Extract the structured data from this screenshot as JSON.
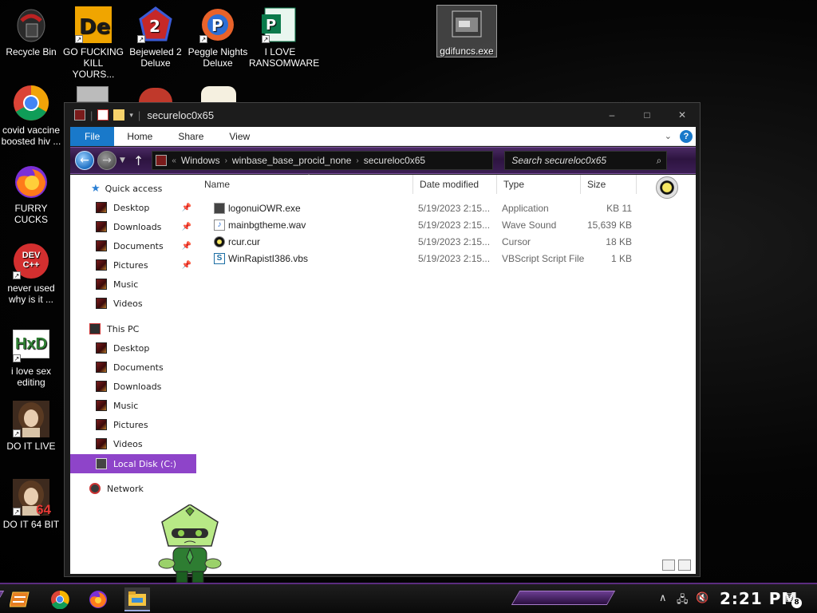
{
  "desktop": {
    "icons": [
      {
        "label": "Recycle Bin"
      },
      {
        "label": "GO FUCKING KILL YOURS..."
      },
      {
        "label": "Bejeweled 2 Deluxe"
      },
      {
        "label": "Peggle Nights Deluxe"
      },
      {
        "label": "I LOVE RANSOMWARE"
      },
      {
        "label": "gdifuncs.exe"
      },
      {
        "label": "covid vaccine boosted hiv ..."
      },
      {
        "label": "FURRY CUCKS"
      },
      {
        "label": "never used why is it ..."
      },
      {
        "label": "i love sex editing"
      },
      {
        "label": "DO IT LIVE"
      },
      {
        "label": "DO IT 64 BIT"
      }
    ],
    "devcpp_text": "DEV C++",
    "hxd_text": "HxD",
    "bit64_text": "64"
  },
  "window": {
    "title": "secureloc0x65",
    "ribbon": {
      "file": "File",
      "home": "Home",
      "share": "Share",
      "view": "View"
    },
    "address": {
      "overflow": "«",
      "crumbs": [
        "Windows",
        "winbase_base_procid_none",
        "secureloc0x65"
      ]
    },
    "search_placeholder": "Search secureloc0x65",
    "navpane": {
      "quick_access": "Quick access",
      "quick_items": [
        "Desktop",
        "Downloads",
        "Documents",
        "Pictures",
        "Music",
        "Videos"
      ],
      "this_pc": "This PC",
      "pc_items": [
        "Desktop",
        "Documents",
        "Downloads",
        "Music",
        "Pictures",
        "Videos"
      ],
      "local_disk": "Local Disk (C:)",
      "network": "Network"
    },
    "columns": {
      "name": "Name",
      "date": "Date modified",
      "type": "Type",
      "size": "Size"
    },
    "files": [
      {
        "name": "logonuiOWR.exe",
        "date": "5/19/2023 2:15...",
        "type": "Application",
        "size": "11 KB"
      },
      {
        "name": "mainbgtheme.wav",
        "date": "5/19/2023 2:15...",
        "type": "Wave Sound",
        "size": "15,639 KB"
      },
      {
        "name": "rcur.cur",
        "date": "5/19/2023 2:15...",
        "type": "Cursor",
        "size": "18 KB"
      },
      {
        "name": "WinRapistI386.vbs",
        "date": "5/19/2023 2:15...",
        "type": "VBScript Script File",
        "size": "1 KB"
      }
    ]
  },
  "taskbar": {
    "clock": "2:21 PM",
    "notification_count": "8"
  },
  "colors": {
    "accent_purple": "#8e44c9",
    "file_tab_blue": "#1979ca"
  }
}
